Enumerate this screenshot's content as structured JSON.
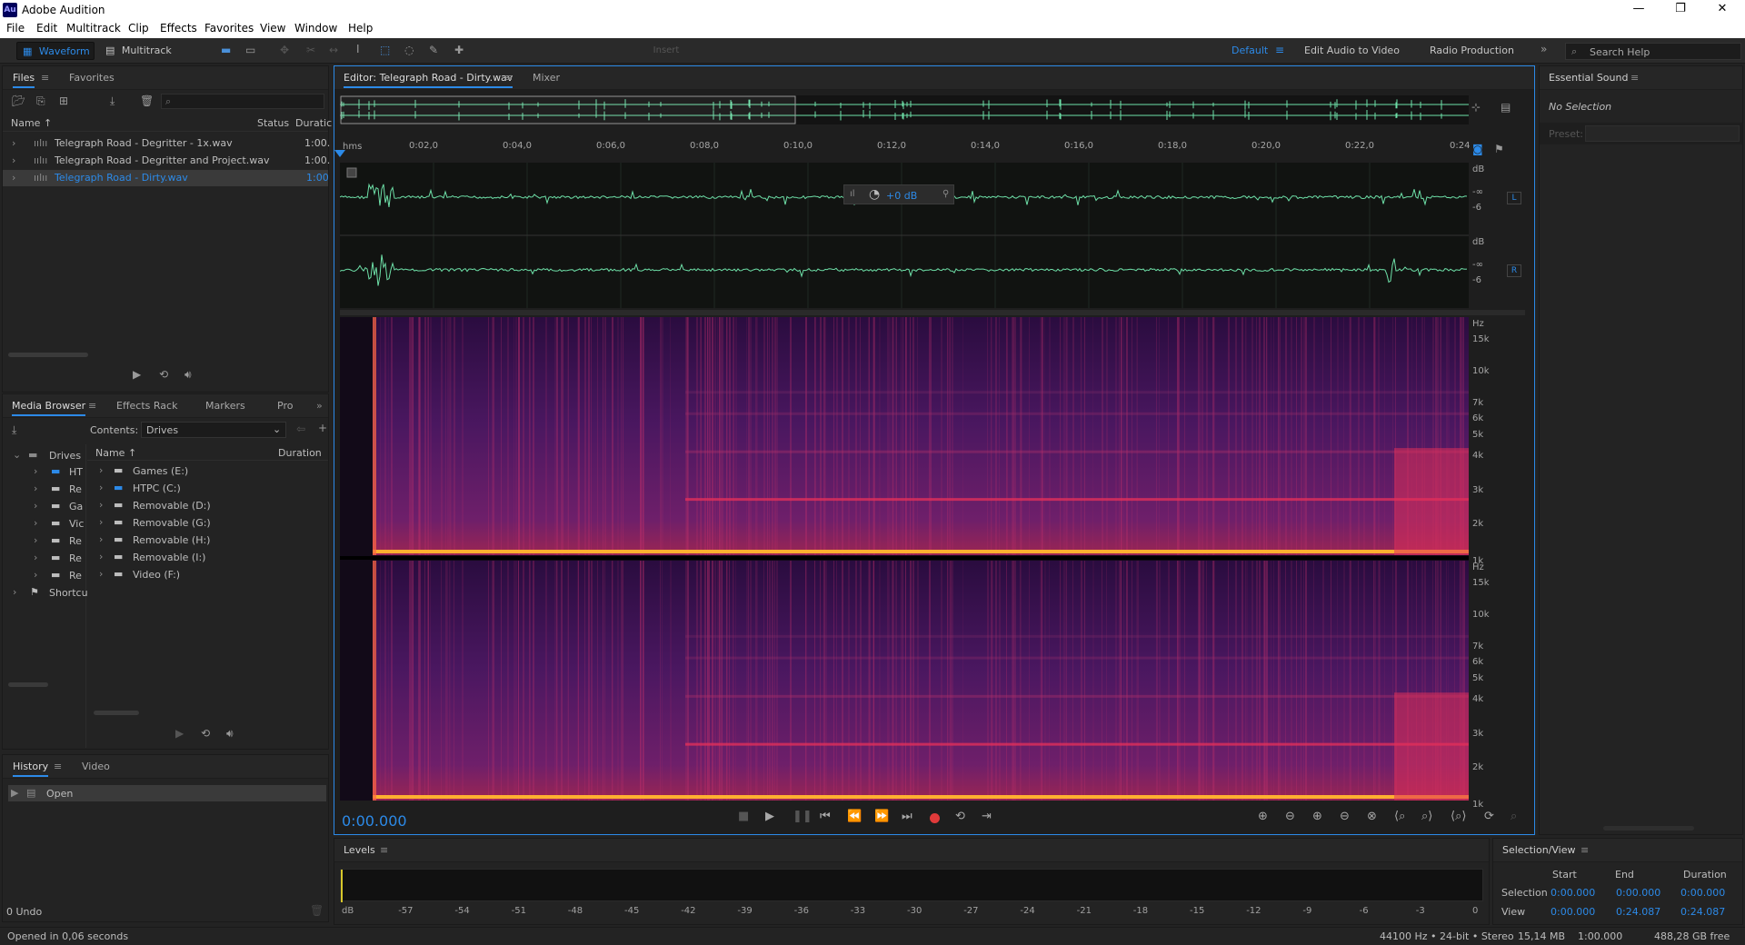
{
  "app": {
    "title": "Adobe Audition",
    "logo": "Au"
  },
  "window_controls": {
    "minimize": "—",
    "maximize": "❐",
    "close": "✕"
  },
  "menu": [
    "File",
    "Edit",
    "Multitrack",
    "Clip",
    "Effects",
    "Favorites",
    "View",
    "Window",
    "Help"
  ],
  "toolbar": {
    "waveform": "Waveform",
    "multitrack": "Multitrack",
    "insert": "Insert",
    "workspaces": [
      "Default",
      "Edit Audio to Video",
      "Radio Production"
    ],
    "search_placeholder": "Search Help"
  },
  "files_panel": {
    "tabs": [
      "Files",
      "Favorites"
    ],
    "columns": [
      "Name",
      "Status",
      "Duratic"
    ],
    "items": [
      {
        "name": "Telegraph Road - Degritter - 1x.wav",
        "duration": "1:00."
      },
      {
        "name": "Telegraph Road - Degritter and Project.wav",
        "duration": "1:00."
      },
      {
        "name": "Telegraph Road - Dirty.wav",
        "duration": "1:00"
      }
    ]
  },
  "media_browser": {
    "tabs": [
      "Media Browser",
      "Effects Rack",
      "Markers",
      "Pro"
    ],
    "contents_label": "Contents:",
    "contents_value": "Drives",
    "tree_root": "Drives",
    "tree_items": [
      "HT",
      "Re",
      "Ga",
      "Vic",
      "Re",
      "Re",
      "Re"
    ],
    "shortcuts": "Shortcu",
    "columns": [
      "Name",
      "Duration"
    ],
    "drives": [
      "Games (E:)",
      "HTPC (C:)",
      "Removable (D:)",
      "Removable (G:)",
      "Removable (H:)",
      "Removable (I:)",
      "Video (F:)"
    ]
  },
  "history_panel": {
    "tabs": [
      "History",
      "Video"
    ],
    "items": [
      "Open"
    ],
    "undo_count": "0 Undo"
  },
  "editor": {
    "tab": "Editor: Telegraph Road - Dirty.wav",
    "mixer_tab": "Mixer",
    "ruler_unit": "hms",
    "ruler_ticks": [
      "0:02,0",
      "0:04,0",
      "0:06,0",
      "0:08,0",
      "0:10,0",
      "0:12,0",
      "0:14,0",
      "0:16,0",
      "0:18,0",
      "0:20,0",
      "0:22,0",
      "0:24"
    ],
    "hud_volume": "+0 dB",
    "channels": [
      "L",
      "R"
    ],
    "db_labels": [
      "dB",
      "-∞",
      "-6"
    ],
    "hz_labels": [
      "Hz",
      "15k",
      "10k",
      "7k",
      "6k",
      "5k",
      "4k",
      "3k",
      "2k",
      "1k"
    ],
    "time": "0:00.000"
  },
  "essential_sound": {
    "title": "Essential Sound",
    "status": "No Selection",
    "preset_label": "Preset:"
  },
  "levels": {
    "title": "Levels",
    "scale": [
      "dB",
      "-57",
      "-54",
      "-51",
      "-48",
      "-45",
      "-42",
      "-39",
      "-36",
      "-33",
      "-30",
      "-27",
      "-24",
      "-21",
      "-18",
      "-15",
      "-12",
      "-9",
      "-6",
      "-3",
      "0"
    ]
  },
  "selection_view": {
    "title": "Selection/View",
    "columns": [
      "Start",
      "End",
      "Duration"
    ],
    "rows": [
      {
        "label": "Selection",
        "start": "0:00.000",
        "end": "0:00.000",
        "duration": "0:00.000"
      },
      {
        "label": "View",
        "start": "0:00.000",
        "end": "0:24.087",
        "duration": "0:24.087"
      }
    ]
  },
  "status_bar": {
    "message": "Opened in 0,06 seconds",
    "format": "44100 Hz • 24-bit • Stereo",
    "size": "15,14 MB",
    "duration": "1:00.000",
    "free": "488,28 GB free"
  },
  "colors": {
    "accent": "#2c8ae8",
    "waveform": "#6ee0a8",
    "record": "#e03a3a"
  }
}
